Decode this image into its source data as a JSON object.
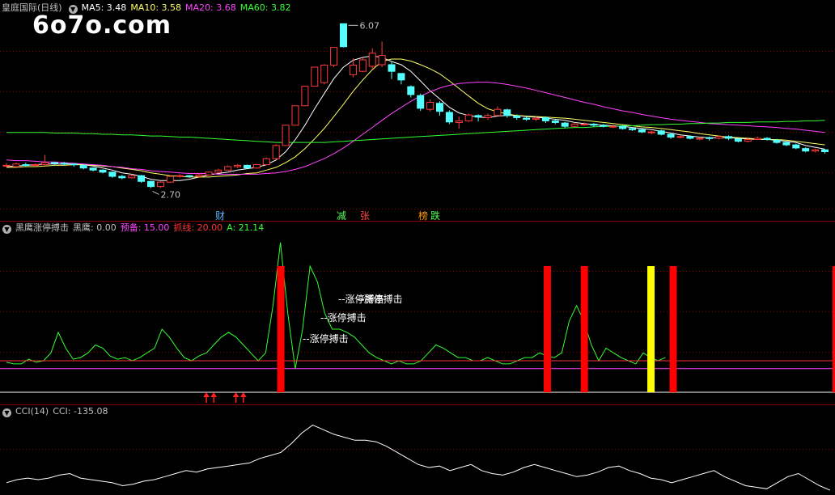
{
  "watermark": "6o7o.com",
  "main_panel": {
    "title": "皇庭国际(日线)",
    "ma_labels": [
      {
        "text": "MA5: 3.48",
        "color": "#ffffff"
      },
      {
        "text": "MA10: 3.58",
        "color": "#ffff66"
      },
      {
        "text": "MA20: 3.68",
        "color": "#ff44ff"
      },
      {
        "text": "MA60: 3.82",
        "color": "#33ff33"
      }
    ],
    "high_label": "6.07",
    "low_label": "2.70",
    "markers": [
      {
        "text": "财",
        "color": "#5ab4ff"
      },
      {
        "text": "减",
        "color": "#55ff55"
      },
      {
        "text": "张",
        "color": "#ff4444"
      },
      {
        "text": "榜",
        "color": "#ff9900"
      },
      {
        "text": "跌",
        "color": "#55ff55"
      }
    ]
  },
  "indicator_panel": {
    "title": "黑鹰涨停搏击",
    "values": [
      {
        "text": "黑鹰: 0.00",
        "color": "#c0c0c0"
      },
      {
        "text": "预备: 15.00",
        "color": "#ff44ff"
      },
      {
        "text": "抓线: 20.00",
        "color": "#ff3333"
      },
      {
        "text": "A: 21.14",
        "color": "#33ff33"
      }
    ],
    "signal_label": "--涨停搏击"
  },
  "cci_panel": {
    "title": "CCI(14)",
    "value_label": "CCI: -135.08"
  },
  "chart_data": [
    {
      "type": "candlestick",
      "title": "皇庭国际(日线)",
      "ylim": [
        2.4,
        6.3
      ],
      "scale": "log",
      "grid": true,
      "candles": [
        [
          3.01,
          3.02,
          3.05,
          2.99
        ],
        [
          3.0,
          3.04,
          3.06,
          2.99
        ],
        [
          3.03,
          3.02,
          3.06,
          3.0
        ],
        [
          3.02,
          3.03,
          3.05,
          3.0
        ],
        [
          3.03,
          3.06,
          3.18,
          3.02
        ],
        [
          3.06,
          3.05,
          3.07,
          3.02
        ],
        [
          3.05,
          3.04,
          3.07,
          3.02
        ],
        [
          3.04,
          3.03,
          3.05,
          3.0
        ],
        [
          3.02,
          2.98,
          3.03,
          2.96
        ],
        [
          2.98,
          2.95,
          2.99,
          2.93
        ],
        [
          2.95,
          2.92,
          2.96,
          2.9
        ],
        [
          2.92,
          2.86,
          2.93,
          2.84
        ],
        [
          2.86,
          2.84,
          2.88,
          2.82
        ],
        [
          2.84,
          2.87,
          2.89,
          2.83
        ],
        [
          2.87,
          2.79,
          2.88,
          2.77
        ],
        [
          2.79,
          2.72,
          2.8,
          2.7
        ],
        [
          2.72,
          2.78,
          2.79,
          2.7
        ],
        [
          2.78,
          2.86,
          2.87,
          2.77
        ],
        [
          2.86,
          2.87,
          2.89,
          2.84
        ],
        [
          2.87,
          2.86,
          2.88,
          2.84
        ],
        [
          2.86,
          2.88,
          2.9,
          2.85
        ],
        [
          2.88,
          2.92,
          2.93,
          2.87
        ],
        [
          2.92,
          2.95,
          2.97,
          2.91
        ],
        [
          2.95,
          3.0,
          3.02,
          2.94
        ],
        [
          3.0,
          3.02,
          3.04,
          2.98
        ],
        [
          3.02,
          2.98,
          3.03,
          2.97
        ],
        [
          2.98,
          3.03,
          3.04,
          2.97
        ],
        [
          3.03,
          3.12,
          3.14,
          3.02
        ],
        [
          3.12,
          3.33,
          3.35,
          3.1
        ],
        [
          3.33,
          3.68,
          3.68,
          3.33
        ],
        [
          3.68,
          4.05,
          4.05,
          3.68
        ],
        [
          4.05,
          4.46,
          4.46,
          4.05
        ],
        [
          4.46,
          4.9,
          4.9,
          4.46
        ],
        [
          4.54,
          4.95,
          4.97,
          4.5
        ],
        [
          4.95,
          5.4,
          5.4,
          4.9
        ],
        [
          6.07,
          5.42,
          6.07,
          5.4
        ],
        [
          4.72,
          4.95,
          5.12,
          4.66
        ],
        [
          4.8,
          5.08,
          5.14,
          4.78
        ],
        [
          4.92,
          5.25,
          5.38,
          4.84
        ],
        [
          4.96,
          5.19,
          5.56,
          4.9
        ],
        [
          4.96,
          4.8,
          5.05,
          4.62
        ],
        [
          4.75,
          4.6,
          4.72,
          4.5
        ],
        [
          4.45,
          4.28,
          4.48,
          4.22
        ],
        [
          4.26,
          4.0,
          4.3,
          3.95
        ],
        [
          3.98,
          4.12,
          4.18,
          3.94
        ],
        [
          4.1,
          3.94,
          4.14,
          3.86
        ],
        [
          3.92,
          3.74,
          3.96,
          3.7
        ],
        [
          3.73,
          3.76,
          3.84,
          3.62
        ],
        [
          3.76,
          3.87,
          3.9,
          3.74
        ],
        [
          3.86,
          3.83,
          3.88,
          3.75
        ],
        [
          3.82,
          3.86,
          3.9,
          3.78
        ],
        [
          3.86,
          3.98,
          4.04,
          3.86
        ],
        [
          3.97,
          3.86,
          3.99,
          3.82
        ],
        [
          3.85,
          3.82,
          3.88,
          3.78
        ],
        [
          3.81,
          3.79,
          3.86,
          3.76
        ],
        [
          3.79,
          3.81,
          3.84,
          3.76
        ],
        [
          3.82,
          3.76,
          3.84,
          3.72
        ],
        [
          3.76,
          3.73,
          3.79,
          3.7
        ],
        [
          3.72,
          3.66,
          3.74,
          3.63
        ],
        [
          3.66,
          3.7,
          3.73,
          3.64
        ],
        [
          3.7,
          3.7,
          3.73,
          3.67
        ],
        [
          3.7,
          3.68,
          3.72,
          3.65
        ],
        [
          3.68,
          3.66,
          3.7,
          3.64
        ],
        [
          3.66,
          3.66,
          3.69,
          3.63
        ],
        [
          3.66,
          3.62,
          3.68,
          3.6
        ],
        [
          3.62,
          3.6,
          3.64,
          3.58
        ],
        [
          3.6,
          3.56,
          3.62,
          3.54
        ],
        [
          3.56,
          3.56,
          3.58,
          3.52
        ],
        [
          3.58,
          3.52,
          3.6,
          3.5
        ],
        [
          3.52,
          3.47,
          3.54,
          3.44
        ],
        [
          3.47,
          3.48,
          3.5,
          3.45
        ],
        [
          3.48,
          3.45,
          3.5,
          3.43
        ],
        [
          3.45,
          3.45,
          3.47,
          3.42
        ],
        [
          3.46,
          3.45,
          3.48,
          3.41
        ],
        [
          3.45,
          3.48,
          3.5,
          3.43
        ],
        [
          3.48,
          3.45,
          3.5,
          3.42
        ],
        [
          3.44,
          3.4,
          3.45,
          3.38
        ],
        [
          3.4,
          3.43,
          3.45,
          3.38
        ],
        [
          3.43,
          3.45,
          3.48,
          3.42
        ],
        [
          3.45,
          3.43,
          3.47,
          3.41
        ],
        [
          3.42,
          3.38,
          3.44,
          3.36
        ],
        [
          3.38,
          3.34,
          3.4,
          3.32
        ],
        [
          3.34,
          3.29,
          3.36,
          3.27
        ],
        [
          3.28,
          3.24,
          3.3,
          3.22
        ],
        [
          3.24,
          3.26,
          3.28,
          3.22
        ],
        [
          3.26,
          3.23,
          3.27,
          3.2
        ]
      ],
      "series": [
        {
          "name": "MA5",
          "color": "#ffffff",
          "values": [
            3.0,
            3.01,
            3.02,
            3.03,
            3.04,
            3.04,
            3.04,
            3.04,
            3.03,
            3.01,
            2.98,
            2.95,
            2.91,
            2.89,
            2.86,
            2.82,
            2.8,
            2.8,
            2.8,
            2.82,
            2.85,
            2.88,
            2.9,
            2.92,
            2.95,
            2.97,
            2.99,
            3.03,
            3.1,
            3.23,
            3.43,
            3.68,
            3.99,
            4.3,
            4.63,
            4.9,
            5.07,
            5.14,
            5.18,
            5.14,
            5.04,
            4.96,
            4.8,
            4.58,
            4.36,
            4.19,
            4.02,
            3.91,
            3.86,
            3.83,
            3.82,
            3.85,
            3.86,
            3.86,
            3.84,
            3.83,
            3.81,
            3.79,
            3.77,
            3.73,
            3.71,
            3.69,
            3.68,
            3.67,
            3.66,
            3.64,
            3.62,
            3.6,
            3.57,
            3.54,
            3.51,
            3.49,
            3.47,
            3.46,
            3.46,
            3.46,
            3.45,
            3.44,
            3.43,
            3.43,
            3.42,
            3.4,
            3.38,
            3.33,
            3.3,
            3.27
          ]
        },
        {
          "name": "MA10",
          "color": "#ffff66",
          "values": [
            2.99,
            2.99,
            3.0,
            3.0,
            3.01,
            3.02,
            3.02,
            3.03,
            3.03,
            3.02,
            3.01,
            3.0,
            2.98,
            2.96,
            2.94,
            2.91,
            2.89,
            2.87,
            2.86,
            2.85,
            2.85,
            2.85,
            2.86,
            2.87,
            2.88,
            2.9,
            2.91,
            2.95,
            2.99,
            3.06,
            3.15,
            3.28,
            3.44,
            3.62,
            3.84,
            4.08,
            4.35,
            4.6,
            4.84,
            5.04,
            5.1,
            5.1,
            5.05,
            4.96,
            4.86,
            4.74,
            4.58,
            4.41,
            4.25,
            4.1,
            3.99,
            3.93,
            3.89,
            3.86,
            3.85,
            3.84,
            3.83,
            3.82,
            3.81,
            3.79,
            3.77,
            3.75,
            3.73,
            3.71,
            3.69,
            3.67,
            3.65,
            3.64,
            3.62,
            3.6,
            3.58,
            3.56,
            3.53,
            3.51,
            3.49,
            3.47,
            3.46,
            3.45,
            3.44,
            3.43,
            3.43,
            3.42,
            3.4,
            3.38,
            3.36,
            3.34
          ]
        },
        {
          "name": "MA20",
          "color": "#ff44ff",
          "values": [
            3.1,
            3.09,
            3.09,
            3.08,
            3.07,
            3.07,
            3.06,
            3.05,
            3.04,
            3.03,
            3.02,
            3.0,
            2.99,
            2.97,
            2.96,
            2.94,
            2.93,
            2.92,
            2.91,
            2.9,
            2.9,
            2.9,
            2.89,
            2.89,
            2.89,
            2.89,
            2.89,
            2.9,
            2.91,
            2.93,
            2.96,
            3.0,
            3.06,
            3.12,
            3.2,
            3.29,
            3.4,
            3.52,
            3.64,
            3.77,
            3.9,
            4.02,
            4.14,
            4.25,
            4.34,
            4.42,
            4.48,
            4.52,
            4.54,
            4.55,
            4.55,
            4.53,
            4.5,
            4.46,
            4.42,
            4.37,
            4.32,
            4.27,
            4.22,
            4.17,
            4.12,
            4.08,
            4.03,
            3.99,
            3.95,
            3.92,
            3.88,
            3.85,
            3.82,
            3.79,
            3.77,
            3.75,
            3.73,
            3.71,
            3.7,
            3.69,
            3.68,
            3.67,
            3.66,
            3.65,
            3.64,
            3.62,
            3.61,
            3.59,
            3.57,
            3.55
          ]
        },
        {
          "name": "MA60",
          "color": "#33ff33",
          "values": [
            3.55,
            3.55,
            3.55,
            3.55,
            3.55,
            3.54,
            3.54,
            3.54,
            3.53,
            3.53,
            3.52,
            3.52,
            3.51,
            3.51,
            3.5,
            3.49,
            3.49,
            3.48,
            3.47,
            3.47,
            3.46,
            3.45,
            3.44,
            3.43,
            3.42,
            3.41,
            3.4,
            3.39,
            3.38,
            3.38,
            3.38,
            3.38,
            3.38,
            3.38,
            3.39,
            3.4,
            3.41,
            3.42,
            3.43,
            3.44,
            3.45,
            3.46,
            3.47,
            3.48,
            3.49,
            3.5,
            3.51,
            3.52,
            3.53,
            3.54,
            3.55,
            3.56,
            3.57,
            3.58,
            3.59,
            3.6,
            3.61,
            3.62,
            3.63,
            3.64,
            3.64,
            3.65,
            3.66,
            3.66,
            3.67,
            3.67,
            3.68,
            3.69,
            3.69,
            3.7,
            3.7,
            3.71,
            3.71,
            3.72,
            3.72,
            3.73,
            3.73,
            3.73,
            3.74,
            3.74,
            3.74,
            3.75,
            3.75,
            3.76,
            3.76,
            3.77
          ]
        }
      ]
    },
    {
      "type": "line",
      "title": "黑鹰涨停搏击",
      "ylim": [
        0,
        100
      ],
      "series": [
        {
          "name": "A",
          "color": "#33ff33",
          "values": [
            19,
            18,
            18,
            21,
            19,
            20,
            25,
            38,
            28,
            21,
            22,
            25,
            30,
            28,
            23,
            21,
            22,
            20,
            22,
            25,
            28,
            40,
            35,
            28,
            22,
            20,
            23,
            25,
            30,
            35,
            38,
            35,
            30,
            25,
            20,
            25,
            55,
            95,
            50,
            15,
            40,
            80,
            70,
            50,
            40,
            40,
            38,
            35,
            30,
            25,
            22,
            20,
            18,
            20,
            18,
            18,
            20,
            25,
            30,
            28,
            25,
            22,
            22,
            20,
            20,
            22,
            20,
            18,
            18,
            20,
            22,
            22,
            25,
            23,
            22,
            25,
            45,
            55,
            45,
            30,
            20,
            28,
            25,
            22,
            20,
            18,
            25,
            22,
            20,
            22
          ]
        },
        {
          "name": "预备",
          "color": "#ff44ff",
          "values": [
            15
          ]
        },
        {
          "name": "抓线",
          "color": "#ff3333",
          "values": [
            20
          ]
        },
        {
          "name": "黑鹰",
          "color": "#ffffff",
          "values": [
            0
          ]
        }
      ],
      "signals": [
        {
          "x": 37,
          "color": "#ff0000",
          "value": 80
        },
        {
          "x": 73,
          "color": "#ff0000",
          "value": 80
        },
        {
          "x": 78,
          "color": "#ff0000",
          "value": 80
        },
        {
          "x": 87,
          "color": "#ffff00",
          "value": 80
        },
        {
          "x": 90,
          "color": "#ff0000",
          "value": 80
        },
        {
          "x": 112,
          "color": "#ff0000",
          "value": 80
        }
      ],
      "arrows": [
        27,
        28,
        31,
        32
      ]
    },
    {
      "type": "line",
      "title": "CCI(14)",
      "series": [
        {
          "name": "CCI",
          "color": "#ffffff",
          "values": [
            -110,
            -100,
            -95,
            -100,
            -95,
            -85,
            -80,
            -95,
            -100,
            -105,
            -110,
            -120,
            -115,
            -105,
            -100,
            -90,
            -80,
            -70,
            -75,
            -65,
            -60,
            -55,
            -50,
            -45,
            -30,
            -20,
            -10,
            20,
            55,
            80,
            65,
            50,
            40,
            30,
            30,
            25,
            10,
            -10,
            -30,
            -50,
            -60,
            -55,
            -70,
            -60,
            -50,
            -70,
            -80,
            -85,
            -75,
            -60,
            -50,
            -60,
            -70,
            -80,
            -90,
            -85,
            -75,
            -60,
            -55,
            -70,
            -80,
            -95,
            -100,
            -110,
            -100,
            -90,
            -80,
            -70,
            -90,
            -105,
            -120,
            -125,
            -130,
            -110,
            -90,
            -80,
            -100,
            -120,
            -135
          ]
        }
      ]
    }
  ]
}
